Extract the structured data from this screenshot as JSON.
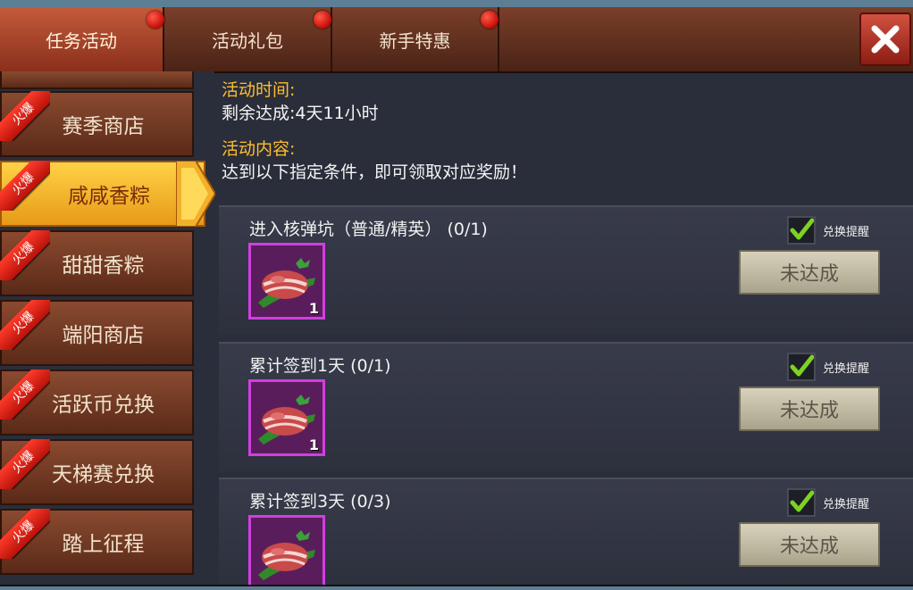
{
  "tabs": [
    {
      "label": "任务活动",
      "active": true,
      "badge": true
    },
    {
      "label": "活动礼包",
      "active": false,
      "badge": true
    },
    {
      "label": "新手特惠",
      "active": false,
      "badge": true
    }
  ],
  "close_icon": "close-x-icon",
  "sidebar": {
    "hot_label": "火爆",
    "items": [
      {
        "label": "赛季商店"
      },
      {
        "label": "咸咸香粽"
      },
      {
        "label": "甜甜香粽"
      },
      {
        "label": "端阳商店"
      },
      {
        "label": "活跃币兑换"
      },
      {
        "label": "天梯赛兑换"
      },
      {
        "label": "踏上征程"
      }
    ],
    "active_index": 1
  },
  "info": {
    "time_label": "活动时间:",
    "time_value": "剩余达成:4天11小时",
    "content_label": "活动内容:",
    "content_value": "达到以下指定条件，即可领取对应奖励！"
  },
  "tasks": [
    {
      "title": "进入核弹坑（普通/精英） (0/1)",
      "reward_count": "1",
      "remind_label": "兑换提醒",
      "remind_checked": true,
      "status": "未达成"
    },
    {
      "title": "累计签到1天 (0/1)",
      "reward_count": "1",
      "remind_label": "兑换提醒",
      "remind_checked": true,
      "status": "未达成"
    },
    {
      "title": "累计签到3天 (0/3)",
      "reward_count": "",
      "remind_label": "兑换提醒",
      "remind_checked": true,
      "status": "未达成"
    }
  ],
  "colors": {
    "accent_gold": "#ffbf2e",
    "item_border": "#d23ee0",
    "badge_red": "#c9110a"
  }
}
